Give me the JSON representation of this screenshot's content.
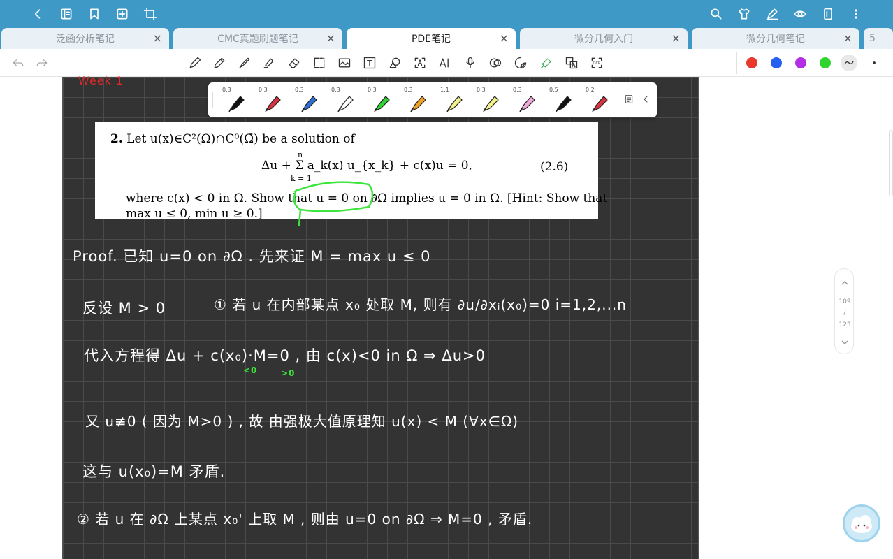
{
  "tabs": [
    {
      "label": "泛函分析笔记",
      "close": "×"
    },
    {
      "label": "CMC真题刷题笔记",
      "close": "×"
    },
    {
      "label": "PDE笔记",
      "close": "×"
    },
    {
      "label": "微分几何入门",
      "close": "×"
    },
    {
      "label": "微分几何笔记",
      "close": "×"
    },
    {
      "label": "5"
    }
  ],
  "colors": {
    "topbar": "#3e99c7",
    "page_bg": "#333333",
    "palette": [
      "#e8392c",
      "#2660f0",
      "#b22fe6",
      "#2fd42f"
    ]
  },
  "topbar_icons": [
    "back-icon",
    "outline-icon",
    "bookmark-icon",
    "add-page-icon",
    "crop-icon",
    "search-icon",
    "shirt-icon",
    "pen-edit-icon",
    "eye-icon",
    "page-layout-icon",
    "more-icon"
  ],
  "tool_icons": [
    "undo-icon",
    "redo-icon",
    "pen-icon",
    "pencil-icon",
    "brush-icon",
    "highlighter-icon",
    "eraser-icon",
    "lasso-icon",
    "image-icon",
    "text-icon",
    "shape-icon",
    "text-recognize-icon",
    "ai-icon",
    "mic-icon",
    "audio-record-icon",
    "sticker-icon",
    "tape-icon",
    "translate-icon",
    "ocr-icon"
  ],
  "pens": [
    {
      "width": "0.3",
      "color": "#111111"
    },
    {
      "width": "0.3",
      "color": "#d9333f"
    },
    {
      "width": "0.3",
      "color": "#2d6fd1"
    },
    {
      "width": "0.3",
      "color": "#ffffff"
    },
    {
      "width": "0.3",
      "color": "#2fd42f"
    },
    {
      "width": "0.3",
      "color": "#f2a020"
    },
    {
      "width": "1.1",
      "color": "#f4f08a"
    },
    {
      "width": "0.3",
      "color": "#f4f08a"
    },
    {
      "width": "0.3",
      "color": "#f2a8d8"
    },
    {
      "width": "0.5",
      "color": "#111111"
    },
    {
      "width": "0.2",
      "color": "#d9333f"
    }
  ],
  "problem": {
    "number": "2.",
    "line1": "Let u(x)∈C²(Ω)∩C⁰(Ω̄) be a solution of",
    "equation": "Δu + Σ a_k(x) u_{x_k} + c(x)u = 0,",
    "sum_top": "n",
    "sum_bottom": "k = 1",
    "eq_number": "(2.6)",
    "line3": "where c(x) < 0 in Ω. Show that u = 0 on ∂Ω implies u = 0 in Ω. [Hint: Show that",
    "line4": "max u ≤ 0, min u ≥ 0.]"
  },
  "handwriting": {
    "top_red": "Week 1",
    "proof": "Proof. 已知 u=0  on ∂Ω .  先来证 M = max u ≤ 0",
    "assume": "反设 M > 0",
    "case1": "① 若 u 在内部某点 x₀ 处取 M,  则有 ∂u/∂xᵢ(x₀)=0   i=1,2,...n",
    "substitute": "代入方程得  Δu + c(x₀)·M=0 ,  由 c(x)<0  in Ω ⇒ Δu>0",
    "note_lt0": "<0",
    "note_gt0": ">0",
    "nonzero": "又 u≢0 ( 因为 M>0 ) , 故 由强极大值原理知  u(x) < M      (∀x∈Ω)",
    "contradiction": "这与 u(x₀)=M   矛盾.",
    "case2": "② 若 u 在 ∂Ω 上某点 x₀' 上取 M ,  则由 u=0  on ∂Ω ⇒ M=0 , 矛盾."
  },
  "page_nav": {
    "current": "109",
    "slash": "/",
    "total": "123"
  }
}
